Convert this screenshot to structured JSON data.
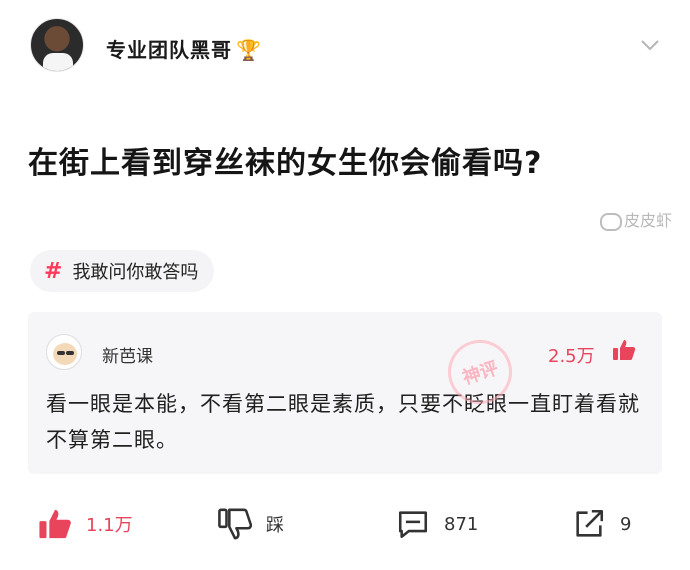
{
  "header": {
    "author_name": "专业团队黑哥",
    "trophy_icon": "trophy-icon",
    "menu_icon": "chevron-down-icon"
  },
  "question": {
    "title": "在街上看到穿丝袜的女生你会偷看吗?"
  },
  "watermark": {
    "text": "皮皮虾"
  },
  "topic": {
    "label": "我敢问你敢答吗"
  },
  "answer": {
    "author_name": "新芭课",
    "likes": "2.5万",
    "text": "看一眼是本能，不看第二眼是素质，只要不眨眼一直盯着看就不算第二眼。",
    "stamp": "神评"
  },
  "actions": {
    "like_count": "1.1万",
    "dislike_label": "踩",
    "comment_count": "871",
    "share_count": "9"
  },
  "colors": {
    "accent": "#e8455c",
    "tag_hash": "#ff3b5c",
    "answer_bg": "#f6f6f8"
  }
}
